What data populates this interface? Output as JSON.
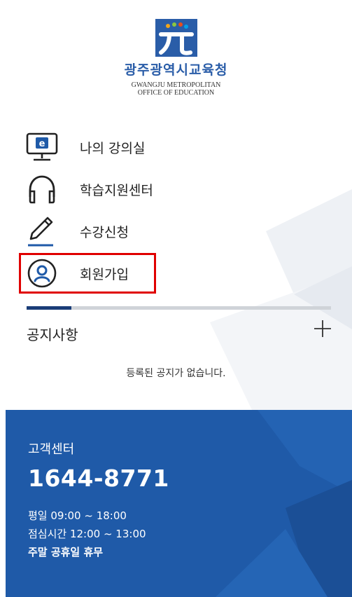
{
  "logo": {
    "name_kr": "광주광역시교육청",
    "name_en_1": "GWANGJU METROPOLITAN",
    "name_en_2": "OFFICE OF EDUCATION"
  },
  "menu": {
    "items": [
      {
        "label": "나의 강의실",
        "icon": "monitor-e-icon"
      },
      {
        "label": "학습지원센터",
        "icon": "headphones-icon"
      },
      {
        "label": "수강신청",
        "icon": "pencil-icon"
      },
      {
        "label": "회원가입",
        "icon": "user-circle-icon"
      }
    ]
  },
  "notice": {
    "title": "공지사항",
    "empty_message": "등록된 공지가 없습니다."
  },
  "customer_center": {
    "title": "고객센터",
    "phone": "1644-8771",
    "hours_weekday": "평일 09:00 ~ 18:00",
    "hours_lunch": "점심시간 12:00 ~ 13:00",
    "hours_holiday": "주말 공휴일 휴무"
  },
  "colors": {
    "brand_blue": "#2a5da8",
    "footer_blue": "#1f5aa8",
    "highlight_red": "#e00000",
    "divider_dark": "#1a3d78"
  }
}
